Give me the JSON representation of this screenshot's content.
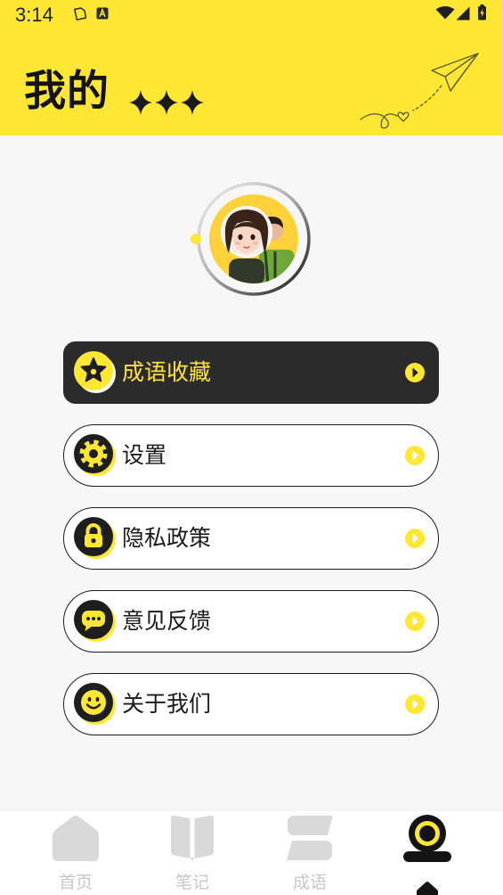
{
  "status_bar": {
    "time": "3:14",
    "left_icons": [
      "sim-card-icon",
      "keyboard-icon"
    ],
    "right_icons": [
      "wifi-icon",
      "signal-icon",
      "battery-charging-icon"
    ]
  },
  "header": {
    "title": "我的",
    "decoration_icons": [
      "sparkle-icon",
      "sparkle-icon",
      "sparkle-icon",
      "paper-plane-icon"
    ]
  },
  "profile": {
    "avatar_icon": "avatar-image"
  },
  "menu": {
    "items": [
      {
        "label": "成语收藏",
        "icon": "star-icon",
        "active": true
      },
      {
        "label": "设置",
        "icon": "gear-icon",
        "active": false
      },
      {
        "label": "隐私政策",
        "icon": "lock-icon",
        "active": false
      },
      {
        "label": "意见反馈",
        "icon": "chat-bubble-icon",
        "active": false
      },
      {
        "label": "关于我们",
        "icon": "smile-icon",
        "active": false
      }
    ],
    "trailing_icon": "chevron-right-icon"
  },
  "bottom_nav": {
    "tabs": [
      {
        "label": "首页",
        "icon": "home-icon",
        "active": false
      },
      {
        "label": "笔记",
        "icon": "book-icon",
        "active": false
      },
      {
        "label": "成语",
        "icon": "idiom-icon",
        "active": false
      },
      {
        "icon": "profile-tab-icon",
        "active": true
      }
    ]
  },
  "colors": {
    "accent": "#FFE733",
    "dark_card": "#2B2B2B",
    "page_background": "#F7F7F7",
    "inactive": "#D9D9D9"
  }
}
